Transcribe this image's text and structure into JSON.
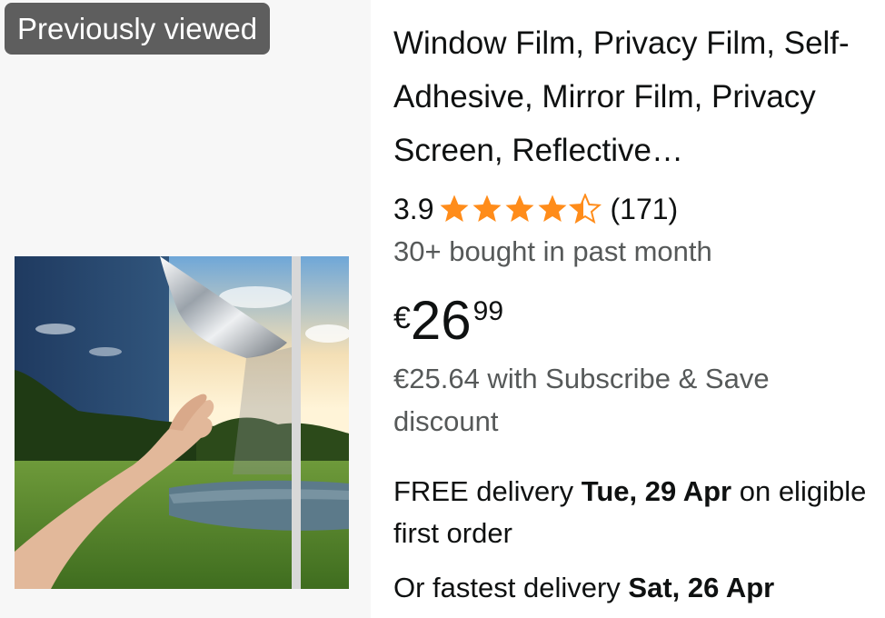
{
  "badge": {
    "label": "Previously viewed"
  },
  "product": {
    "title": "Window Film, Privacy Film, Self-Adhesive, Mirror Film, Privacy Screen, Reflective…",
    "rating": "3.9",
    "rating_value": 3.9,
    "review_count": "(171)",
    "bought": "30+ bought in past month",
    "price": {
      "currency": "€",
      "whole": "26",
      "fraction": "99"
    },
    "subscribe_text": "€25.64 with Subscribe & Save discount",
    "delivery": {
      "prefix": "FREE delivery ",
      "date": "Tue, 29 Apr",
      "suffix": " on eligible first order"
    },
    "fastest": {
      "prefix": "Or fastest delivery ",
      "date": "Sat, 26 Apr"
    },
    "image": {
      "icon": "window-mirror-film-photo"
    }
  },
  "colors": {
    "star": "#ff8c1a",
    "badge_bg": "#5e5e5e",
    "secondary_text": "#565959",
    "image_panel_bg": "#f7f7f7"
  }
}
